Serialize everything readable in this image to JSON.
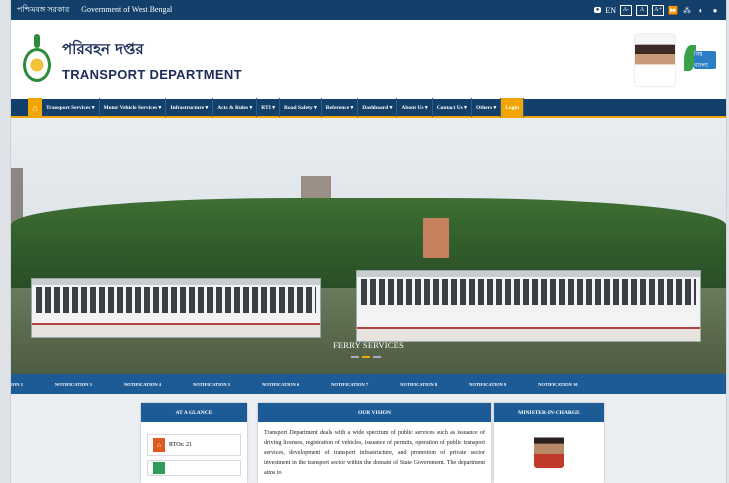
{
  "topbar": {
    "gov_bn": "পশ্চিমবঙ্গ সরকার",
    "gov_en": "Government of West Bengal",
    "lang": "EN",
    "font_small": "A-",
    "font_normal": "A",
    "font_large": "A+"
  },
  "header": {
    "title_bn": "পরিবহন দপ্তর",
    "title_en": "TRANSPORT DEPARTMENT",
    "badge": "বিশ্ব বাংলা"
  },
  "nav": {
    "items": [
      "Transport Services ▾",
      "Motor Vehicle Services ▾",
      "Infrastructure ▾",
      "Acts & Rules ▾",
      "RTI ▾",
      "Road Safety ▾",
      "Reference ▾",
      "Dashboard ▾",
      "About Us ▾",
      "Contact Us ▾",
      "Others ▾",
      "Login"
    ]
  },
  "banner": {
    "caption": "FERRY SERVICES"
  },
  "ticker": {
    "items": [
      "ION 2",
      "NOTIFICATION 3",
      "NOTIFICATION 4",
      "NOTIFICATION 5",
      "NOTIFICATION 6",
      "NOTIFICATION 7",
      "NOTIFICATION 8",
      "NOTIFICATION 9",
      "NOTIFICATION 10"
    ]
  },
  "cards": {
    "glance": {
      "title": "AT A GLANCE",
      "rto": "RTOs: 21"
    },
    "vision": {
      "title": "OUR VISION",
      "text": "Transport Department deals with a wide spectrum of public services such as issuance of driving licenses, registration of vehicles, issuance of permits, operation of public transport services, development of transport infrastructure, and promotion of private sector investment in the transport sector within the domain of State Government. The department aims to"
    },
    "minister": {
      "title": "MINISTER-IN-CHARGE"
    }
  }
}
